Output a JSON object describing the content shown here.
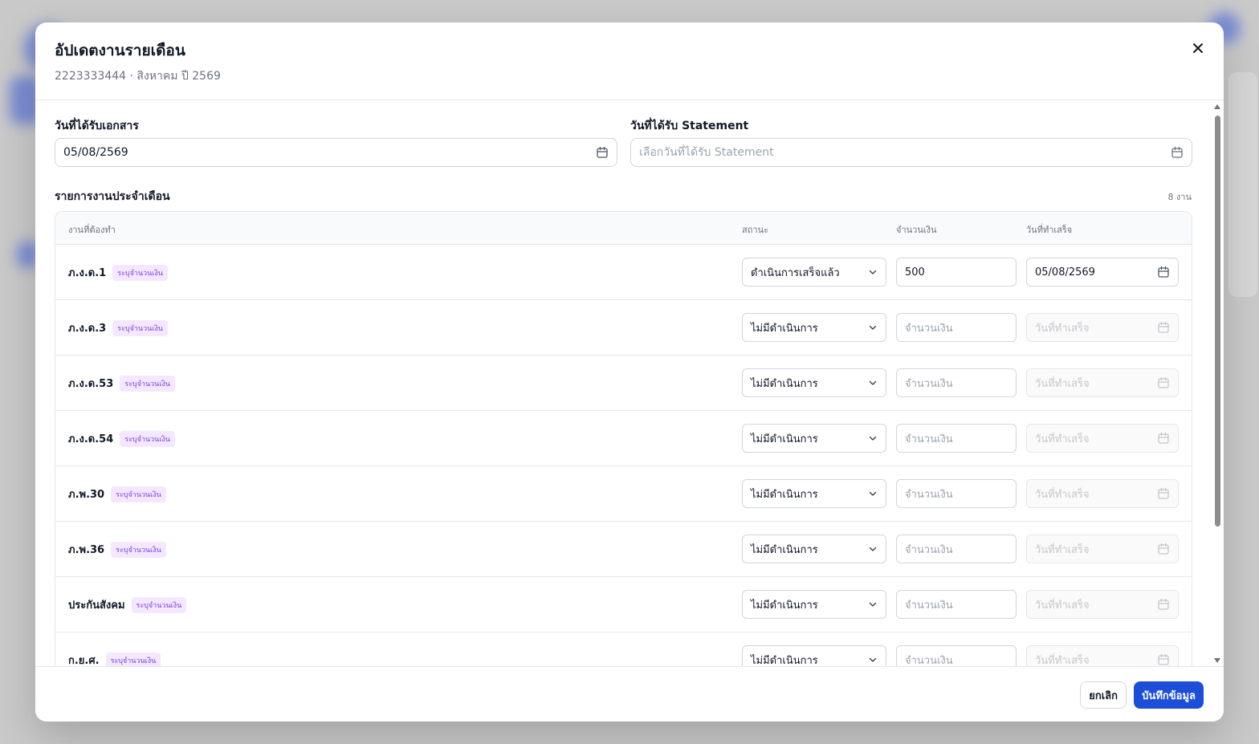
{
  "modal": {
    "title": "อัปเดตงานรายเดือน",
    "subtitle": "2223333444 · สิงหาคม ปี 2569",
    "close_icon": "close-icon"
  },
  "fields": {
    "doc_received": {
      "label": "วันที่ได้รับเอกสาร",
      "value": "05/08/2569",
      "icon": "calendar-icon"
    },
    "statement_received": {
      "label": "วันที่ได้รับ Statement",
      "placeholder": "เลือกวันที่ได้รับ Statement",
      "value": "",
      "icon": "calendar-icon"
    }
  },
  "tasks_section": {
    "title": "รายการงานประจำเดือน",
    "count": "8 งาน",
    "columns": {
      "task": "งานที่ต้องทำ",
      "status": "สถานะ",
      "amount": "จำนวนเงิน",
      "done_date": "วันที่ทำเสร็จ"
    },
    "rows": [
      {
        "name": "ภ.ง.ด.1",
        "badge": "ระบุจำนวนเงิน",
        "status": "ดำเนินการเสร็จแล้ว",
        "amount": "500",
        "amount_placeholder": "จำนวนเงิน",
        "done_date": "05/08/2569",
        "done_date_placeholder": "วันที่ทำเสร็จ"
      },
      {
        "name": "ภ.ง.ด.3",
        "badge": "ระบุจำนวนเงิน",
        "status": "ไม่มีดำเนินการ",
        "amount": "",
        "amount_placeholder": "จำนวนเงิน",
        "done_date": "",
        "done_date_placeholder": "วันที่ทำเสร็จ"
      },
      {
        "name": "ภ.ง.ด.53",
        "badge": "ระบุจำนวนเงิน",
        "status": "ไม่มีดำเนินการ",
        "amount": "",
        "amount_placeholder": "จำนวนเงิน",
        "done_date": "",
        "done_date_placeholder": "วันที่ทำเสร็จ"
      },
      {
        "name": "ภ.ง.ด.54",
        "badge": "ระบุจำนวนเงิน",
        "status": "ไม่มีดำเนินการ",
        "amount": "",
        "amount_placeholder": "จำนวนเงิน",
        "done_date": "",
        "done_date_placeholder": "วันที่ทำเสร็จ"
      },
      {
        "name": "ภ.พ.30",
        "badge": "ระบุจำนวนเงิน",
        "status": "ไม่มีดำเนินการ",
        "amount": "",
        "amount_placeholder": "จำนวนเงิน",
        "done_date": "",
        "done_date_placeholder": "วันที่ทำเสร็จ"
      },
      {
        "name": "ภ.พ.36",
        "badge": "ระบุจำนวนเงิน",
        "status": "ไม่มีดำเนินการ",
        "amount": "",
        "amount_placeholder": "จำนวนเงิน",
        "done_date": "",
        "done_date_placeholder": "วันที่ทำเสร็จ"
      },
      {
        "name": "ประกันสังคม",
        "badge": "ระบุจำนวนเงิน",
        "status": "ไม่มีดำเนินการ",
        "amount": "",
        "amount_placeholder": "จำนวนเงิน",
        "done_date": "",
        "done_date_placeholder": "วันที่ทำเสร็จ"
      },
      {
        "name": "ก.ย.ศ.",
        "badge": "ระบุจำนวนเงิน",
        "status": "ไม่มีดำเนินการ",
        "amount": "",
        "amount_placeholder": "จำนวนเงิน",
        "done_date": "",
        "done_date_placeholder": "วันที่ทำเสร็จ"
      }
    ]
  },
  "footer": {
    "cancel_label": "ยกเลิก",
    "save_label": "บันทึกข้อมูล"
  },
  "colors": {
    "primary": "#1d4ed8",
    "badge_text": "#7c3aed",
    "badge_bg": "#f3e8ff",
    "overlay": "#c9c9c9"
  }
}
